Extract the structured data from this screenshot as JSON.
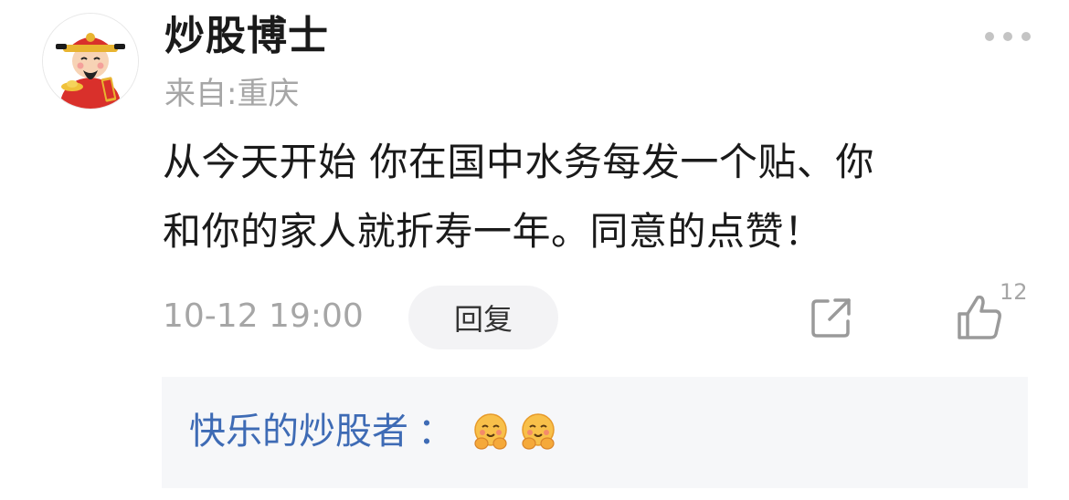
{
  "comment": {
    "username": "炒股博士",
    "location": "来自:重庆",
    "content_line1": "从今天开始 你在国中水务每发一个贴、你",
    "content_line2": "和你的家人就折寿一年。同意的点赞！",
    "timestamp": "10-12 19:00",
    "reply_label": "回复",
    "like_count": "12"
  },
  "sub_reply": {
    "author": "快乐的炒股者",
    "colon": "：",
    "emojis": [
      "hug-emoji",
      "hug-emoji"
    ]
  },
  "colors": {
    "accent_link": "#3e6bb5",
    "secondary_text": "#a6a6a6",
    "panel_bg": "#f6f7f9"
  }
}
